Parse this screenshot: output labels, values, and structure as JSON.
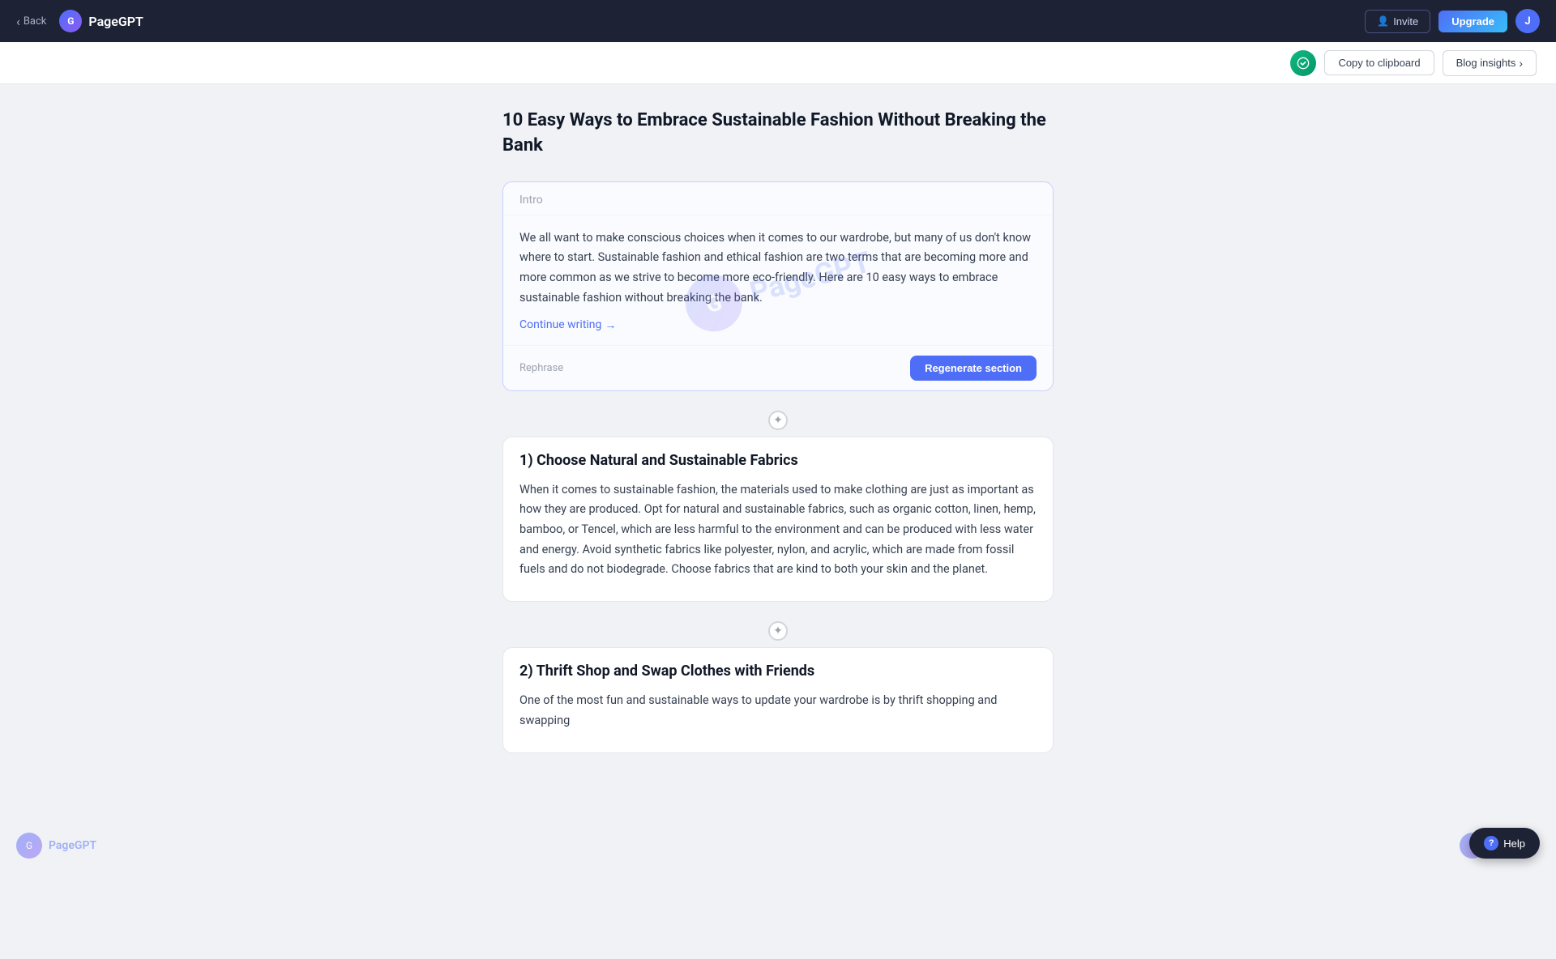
{
  "navbar": {
    "back_label": "Back",
    "logo_text": "PageGPT",
    "logo_initial": "G",
    "invite_label": "Invite",
    "upgrade_label": "Upgrade",
    "avatar_initial": "J"
  },
  "toolbar": {
    "clipboard_label": "Copy to clipboard",
    "blog_insights_label": "Blog insights"
  },
  "article": {
    "title": "10 Easy Ways to Embrace Sustainable Fashion Without Breaking the Bank",
    "sections": [
      {
        "id": "intro",
        "label": "Intro",
        "body_text": "We all want to make conscious choices when it comes to our wardrobe, but many of us don't know where to start. Sustainable fashion and ethical fashion are two terms that are becoming more and more common as we strive to become more eco-friendly. Here are 10 easy ways to embrace sustainable fashion without breaking the bank.",
        "continue_writing_label": "Continue writing",
        "rephrase_label": "Rephrase",
        "regenerate_label": "Regenerate section",
        "highlighted": true
      },
      {
        "id": "section1",
        "heading": "1) Choose Natural and Sustainable Fabrics",
        "body_text": "When it comes to sustainable fashion, the materials used to make clothing are just as important as how they are produced. Opt for natural and sustainable fabrics, such as organic cotton, linen, hemp, bamboo, or Tencel, which are less harmful to the environment and can be produced with less water and energy. Avoid synthetic fabrics like polyester, nylon, and acrylic, which are made from fossil fuels and do not biodegrade. Choose fabrics that are kind to both your skin and the planet.",
        "highlighted": false
      },
      {
        "id": "section2",
        "heading": "2) Thrift Shop and Swap Clothes with Friends",
        "body_text": "One of the most fun and sustainable ways to update your wardrobe is by thrift shopping and swapping",
        "highlighted": false
      }
    ]
  },
  "help": {
    "label": "Help"
  },
  "watermark": {
    "text": "PageGPT",
    "icon": "G"
  }
}
